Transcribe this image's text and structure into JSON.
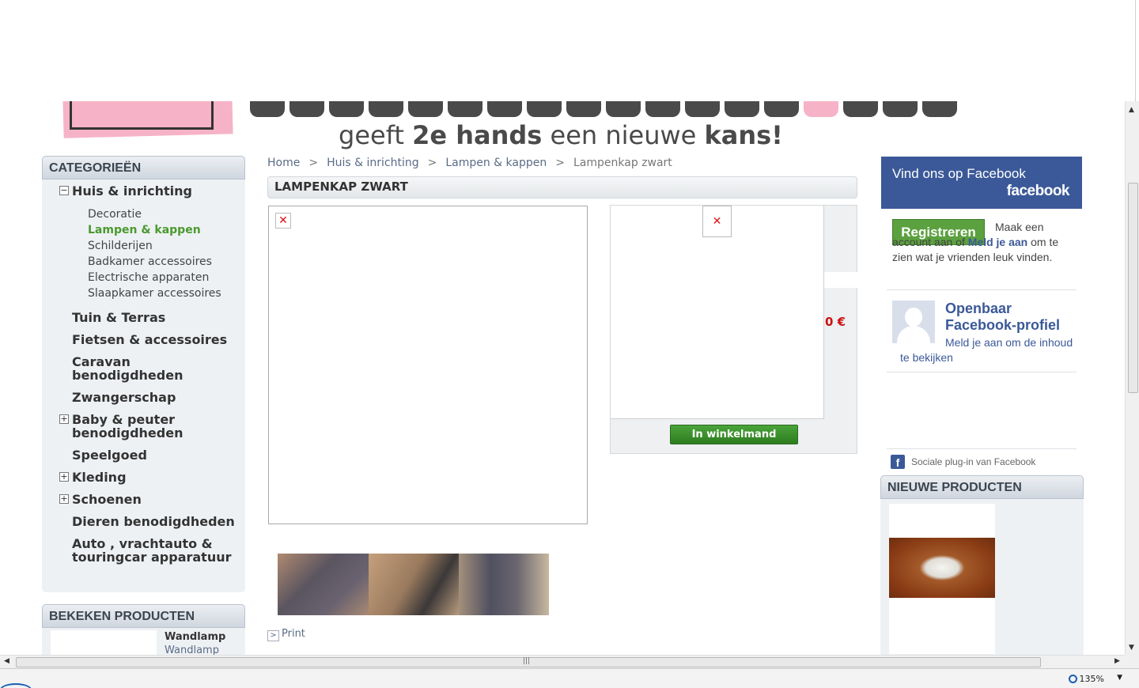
{
  "header": {
    "tagline_pre": "geeft ",
    "tagline_b1": "2e hands",
    "tagline_mid": " een nieuwe ",
    "tagline_b2": "kans!"
  },
  "categories": {
    "title": "CATEGORIEËN",
    "items": [
      {
        "label": "Huis & inrichting",
        "marker": "−"
      },
      {
        "label": "Tuin & Terras",
        "marker": ""
      },
      {
        "label": "Fietsen & accessoires",
        "marker": ""
      },
      {
        "label": "Caravan benodigdheden",
        "marker": ""
      },
      {
        "label": "Zwangerschap",
        "marker": ""
      },
      {
        "label": "Baby & peuter benodigdheden",
        "marker": "+"
      },
      {
        "label": "Speelgoed",
        "marker": ""
      },
      {
        "label": "Kleding",
        "marker": "+"
      },
      {
        "label": "Schoenen",
        "marker": "+"
      },
      {
        "label": "Dieren benodigdheden",
        "marker": ""
      },
      {
        "label": "Auto , vrachtauto & touringcar apparatuur",
        "marker": ""
      }
    ],
    "subitems": [
      {
        "label": "Decoratie"
      },
      {
        "label": "Lampen & kappen"
      },
      {
        "label": "Schilderijen"
      },
      {
        "label": "Badkamer accessoires"
      },
      {
        "label": "Electrische apparaten"
      },
      {
        "label": "Slaapkamer accessoires"
      }
    ]
  },
  "viewed": {
    "title": "BEKEKEN PRODUCTEN",
    "name": "Wandlamp",
    "sub": "Wandlamp"
  },
  "breadcrumb": {
    "home": "Home",
    "sep": ">",
    "level1": "Huis & inrichting",
    "level2": "Lampen & kappen",
    "current": "Lampenkap zwart"
  },
  "product": {
    "title": "LAMPENKAP ZWART",
    "broken_icon": "✕",
    "price": "0 €",
    "cart_label": "In winkelmand",
    "print_icon": ">",
    "print_label": "Print"
  },
  "facebook": {
    "header": "Vind ons op Facebook",
    "logo": "facebook",
    "register": "Registreren",
    "desc_text": "Maak een account aan of ",
    "desc_link": "Meld je aan",
    "desc_rest": " om te zien wat je vrienden leuk vinden.",
    "profile_title": "Openbaar Facebook-profiel",
    "profile_sub": "Meld je aan om de inhoud te bekijken",
    "plugin_icon": "f",
    "plugin_label": "Sociale plug-in van Facebook"
  },
  "new_products": {
    "title": "NIEUWE PRODUCTEN"
  },
  "status": {
    "zoom": "135%",
    "dropdown": "▼"
  },
  "scroll": {
    "up": "▲",
    "down": "▼",
    "left": "◀",
    "right": "▶",
    "grip": "|||"
  }
}
